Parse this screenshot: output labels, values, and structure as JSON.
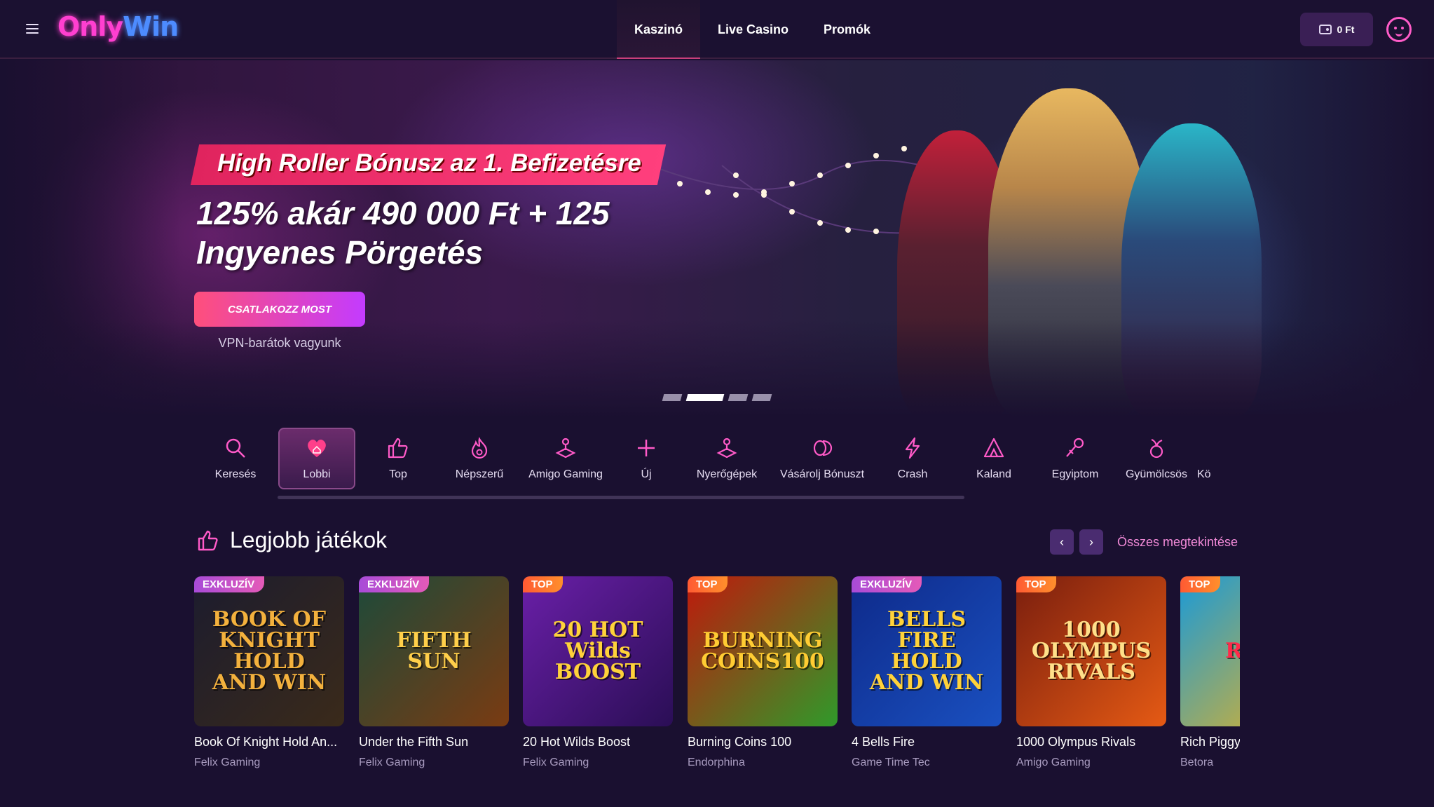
{
  "header": {
    "logo_part1": "Only",
    "logo_part2": "Win",
    "nav": [
      {
        "label": "Kaszinó",
        "active": true
      },
      {
        "label": "Live Casino",
        "active": false
      },
      {
        "label": "Promók",
        "active": false
      }
    ],
    "balance": "0 Ft",
    "icons": {
      "menu": "hamburger-menu-icon",
      "wallet": "wallet-icon",
      "avatar": "avatar-face-icon"
    }
  },
  "hero": {
    "badge_title": "High Roller Bónusz az 1. Befizetésre",
    "subtitle": "125% akár 490 000 Ft + 125 Ingyenes Pörgetés",
    "cta": "CSATLAKOZZ MOST",
    "note": "VPN-barátok vagyunk",
    "slides_count": 4,
    "active_slide": 1
  },
  "categories": [
    {
      "label": "Keresés",
      "icon": "search-icon"
    },
    {
      "label": "Lobbi",
      "icon": "heart-home-icon",
      "active": true
    },
    {
      "label": "Top",
      "icon": "thumbs-up-icon"
    },
    {
      "label": "Népszerű",
      "icon": "flame-icon"
    },
    {
      "label": "Amigo Gaming",
      "icon": "joystick-icon"
    },
    {
      "label": "Új",
      "icon": "plus-icon"
    },
    {
      "label": "Nyerőgépek",
      "icon": "joystick-icon"
    },
    {
      "label": "Vásárolj Bónuszt",
      "icon": "coins-icon"
    },
    {
      "label": "Crash",
      "icon": "lightning-icon"
    },
    {
      "label": "Kaland",
      "icon": "tent-icon"
    },
    {
      "label": "Egyiptom",
      "icon": "ankh-icon"
    },
    {
      "label": "Gyümölcsös",
      "icon": "cherry-icon"
    },
    {
      "label": "Kö",
      "icon": "none"
    }
  ],
  "section": {
    "title": "Legjobb játékok",
    "see_all": "Összes megtekintése",
    "prev": "‹",
    "next": "›"
  },
  "games": [
    {
      "badge": "EXKLUZÍV",
      "badge_type": "exk",
      "title": "Book Of Knight Hold An...",
      "provider": "Felix Gaming",
      "art": "BOOK OF KNIGHT HOLD AND WIN",
      "colors": [
        "#1c1c2e",
        "#3a2a1a"
      ],
      "text_color": "#f3b13d"
    },
    {
      "badge": "EXKLUZÍV",
      "badge_type": "exk",
      "title": "Under the Fifth Sun",
      "provider": "Felix Gaming",
      "art": "FIFTH SUN",
      "colors": [
        "#1d4a3a",
        "#7a3b12"
      ],
      "text_color": "#ffcf4a"
    },
    {
      "badge": "TOP",
      "badge_type": "top",
      "title": "20 Hot Wilds Boost",
      "provider": "Felix Gaming",
      "art": "20 HOT Wilds BOOST",
      "colors": [
        "#6a1fa8",
        "#2a0e55"
      ],
      "text_color": "#ffd23a"
    },
    {
      "badge": "TOP",
      "badge_type": "top",
      "title": "Burning Coins 100",
      "provider": "Endorphina",
      "art": "BURNING COINS100",
      "colors": [
        "#c0180c",
        "#2f9a2a"
      ],
      "text_color": "#ffcc33"
    },
    {
      "badge": "EXKLUZÍV",
      "badge_type": "exk",
      "title": "4 Bells Fire",
      "provider": "Game Time Tec",
      "art": "BELLS FIRE HOLD AND WIN",
      "colors": [
        "#0e2a8a",
        "#1a50c0"
      ],
      "text_color": "#ffd23a"
    },
    {
      "badge": "TOP",
      "badge_type": "top",
      "title": "1000 Olympus Rivals",
      "provider": "Amigo Gaming",
      "art": "1000 OLYMPUS RIVALS",
      "colors": [
        "#7a1e0e",
        "#e55a14"
      ],
      "text_color": "#ffe08a"
    },
    {
      "badge": "TOP",
      "badge_type": "top",
      "title": "Rich Piggy",
      "provider": "Betora",
      "art": "RI PI",
      "colors": [
        "#1a9ad8",
        "#f0b419"
      ],
      "text_color": "#ff2a4a"
    }
  ]
}
